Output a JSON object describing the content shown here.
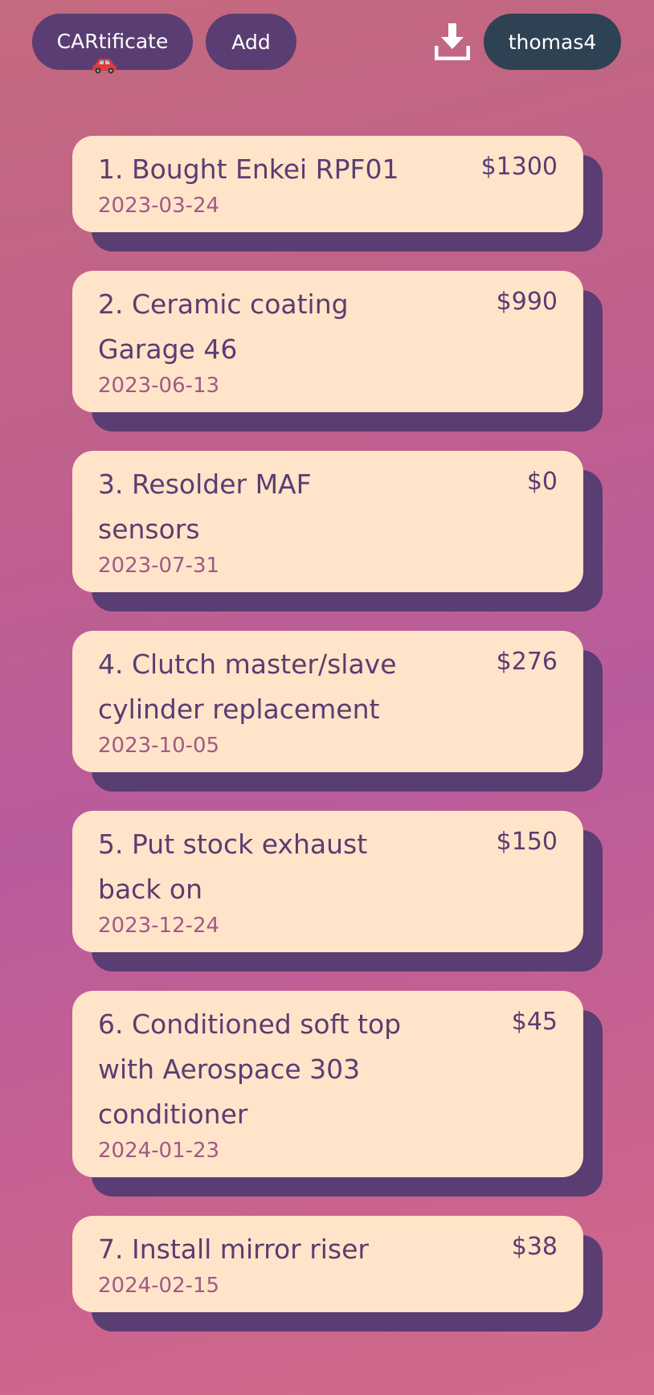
{
  "header": {
    "brand_label": "CARtificate",
    "brand_icon": "car-icon",
    "add_label": "Add",
    "download_icon": "download-icon",
    "user_label": "thomas4",
    "colors": {
      "pill_purple": "#5a3d72",
      "pill_slate": "#2f4254",
      "card_bg": "#ffe4c9",
      "card_shadow": "#5a3d72",
      "date_text": "#a05a86"
    }
  },
  "entries": [
    {
      "title": "1. Bought Enkei RPF01",
      "date": "2023-03-24",
      "price": "$1300"
    },
    {
      "title": "2. Ceramic coating Garage 46",
      "date": "2023-06-13",
      "price": "$990"
    },
    {
      "title": "3. Resolder MAF sensors",
      "date": "2023-07-31",
      "price": "$0"
    },
    {
      "title": "4. Clutch master/slave cylinder replacement",
      "date": "2023-10-05",
      "price": "$276"
    },
    {
      "title": "5. Put stock exhaust back on",
      "date": "2023-12-24",
      "price": "$150"
    },
    {
      "title": "6. Conditioned soft top with Aerospace 303 conditioner",
      "date": "2024-01-23",
      "price": "$45"
    },
    {
      "title": "7. Install mirror riser",
      "date": "2024-02-15",
      "price": "$38"
    }
  ]
}
